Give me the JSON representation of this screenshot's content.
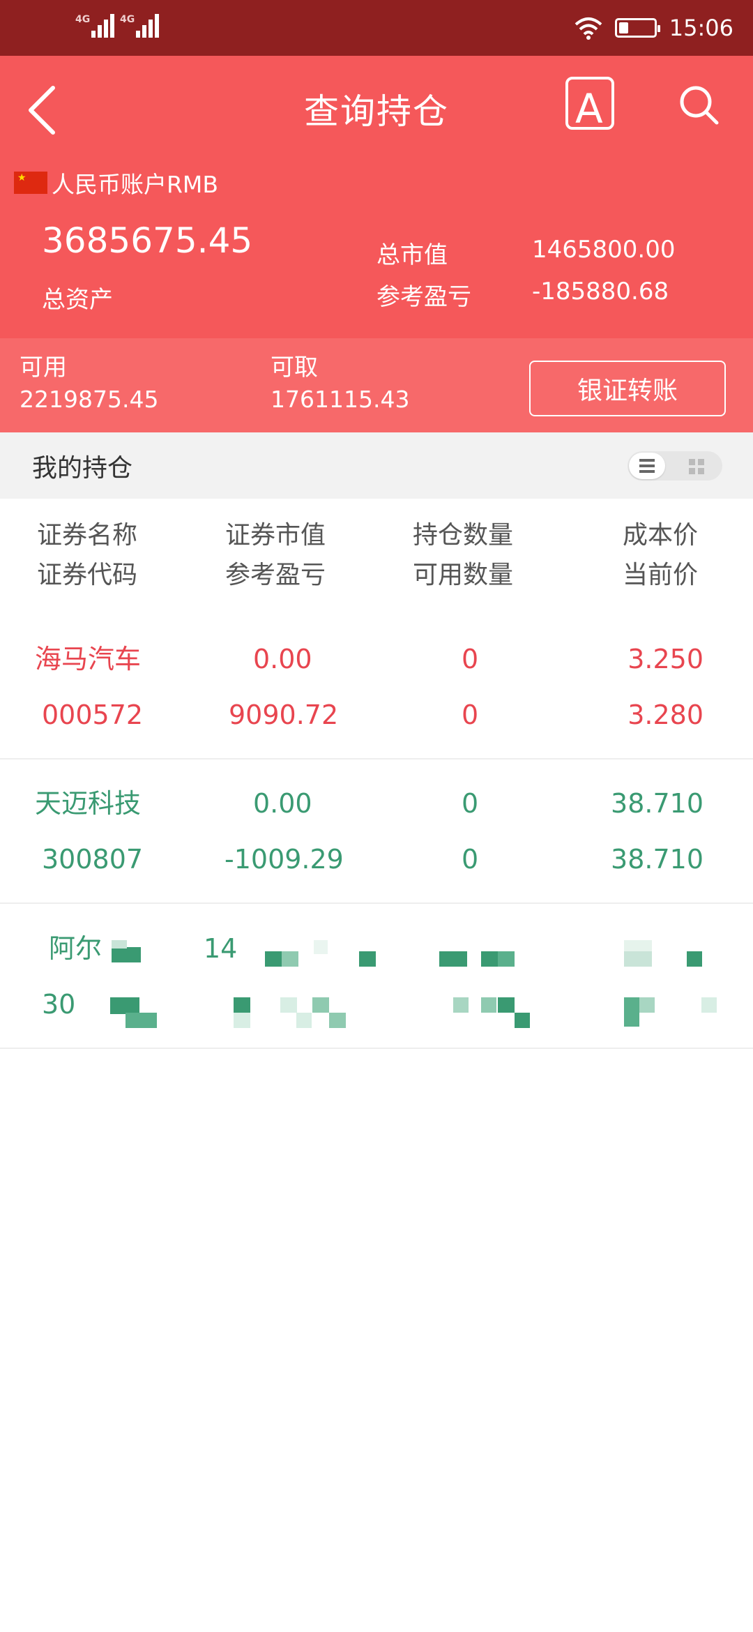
{
  "status_bar": {
    "network1": "4G",
    "network2": "4G",
    "time": "15:06",
    "battery_level": 0.25
  },
  "header": {
    "title": "查询持仓",
    "font_button": "A",
    "account_label": "人民币账户RMB",
    "total_assets": "3685675.45",
    "total_assets_label": "总资产",
    "market_value_label": "总市值",
    "market_value": "1465800.00",
    "profit_loss_label": "参考盈亏",
    "profit_loss": "-185880.68"
  },
  "subheader": {
    "available_label": "可用",
    "available": "2219875.45",
    "withdrawable_label": "可取",
    "withdrawable": "1761115.43",
    "transfer_button": "银证转账"
  },
  "holdings": {
    "title": "我的持仓"
  },
  "columns": {
    "name": "证券名称",
    "code": "证券代码",
    "market_value": "证券市值",
    "profit_loss": "参考盈亏",
    "position": "持仓数量",
    "available_qty": "可用数量",
    "cost_price": "成本价",
    "current_price": "当前价"
  },
  "rows": [
    {
      "name": "海马汽车",
      "code": "000572",
      "market_value": "0.00",
      "profit_loss": "9090.72",
      "position": "0",
      "available_qty": "0",
      "cost_price": "3.250",
      "current_price": "3.280",
      "color": "#e8454f"
    },
    {
      "name": "天迈科技",
      "code": "300807",
      "market_value": "0.00",
      "profit_loss": "-1009.29",
      "position": "0",
      "available_qty": "0",
      "cost_price": "38.710",
      "current_price": "38.710",
      "color": "#3a9a72"
    },
    {
      "name": "阿尔",
      "code": "30",
      "market_value": "14",
      "color": "#3a9a72"
    }
  ],
  "colors": {
    "status_bar": "#8f2020",
    "header": "#f5585a",
    "subheader": "#f7696a",
    "loss_green": "#3a9a72",
    "gain_red": "#e8454f"
  }
}
